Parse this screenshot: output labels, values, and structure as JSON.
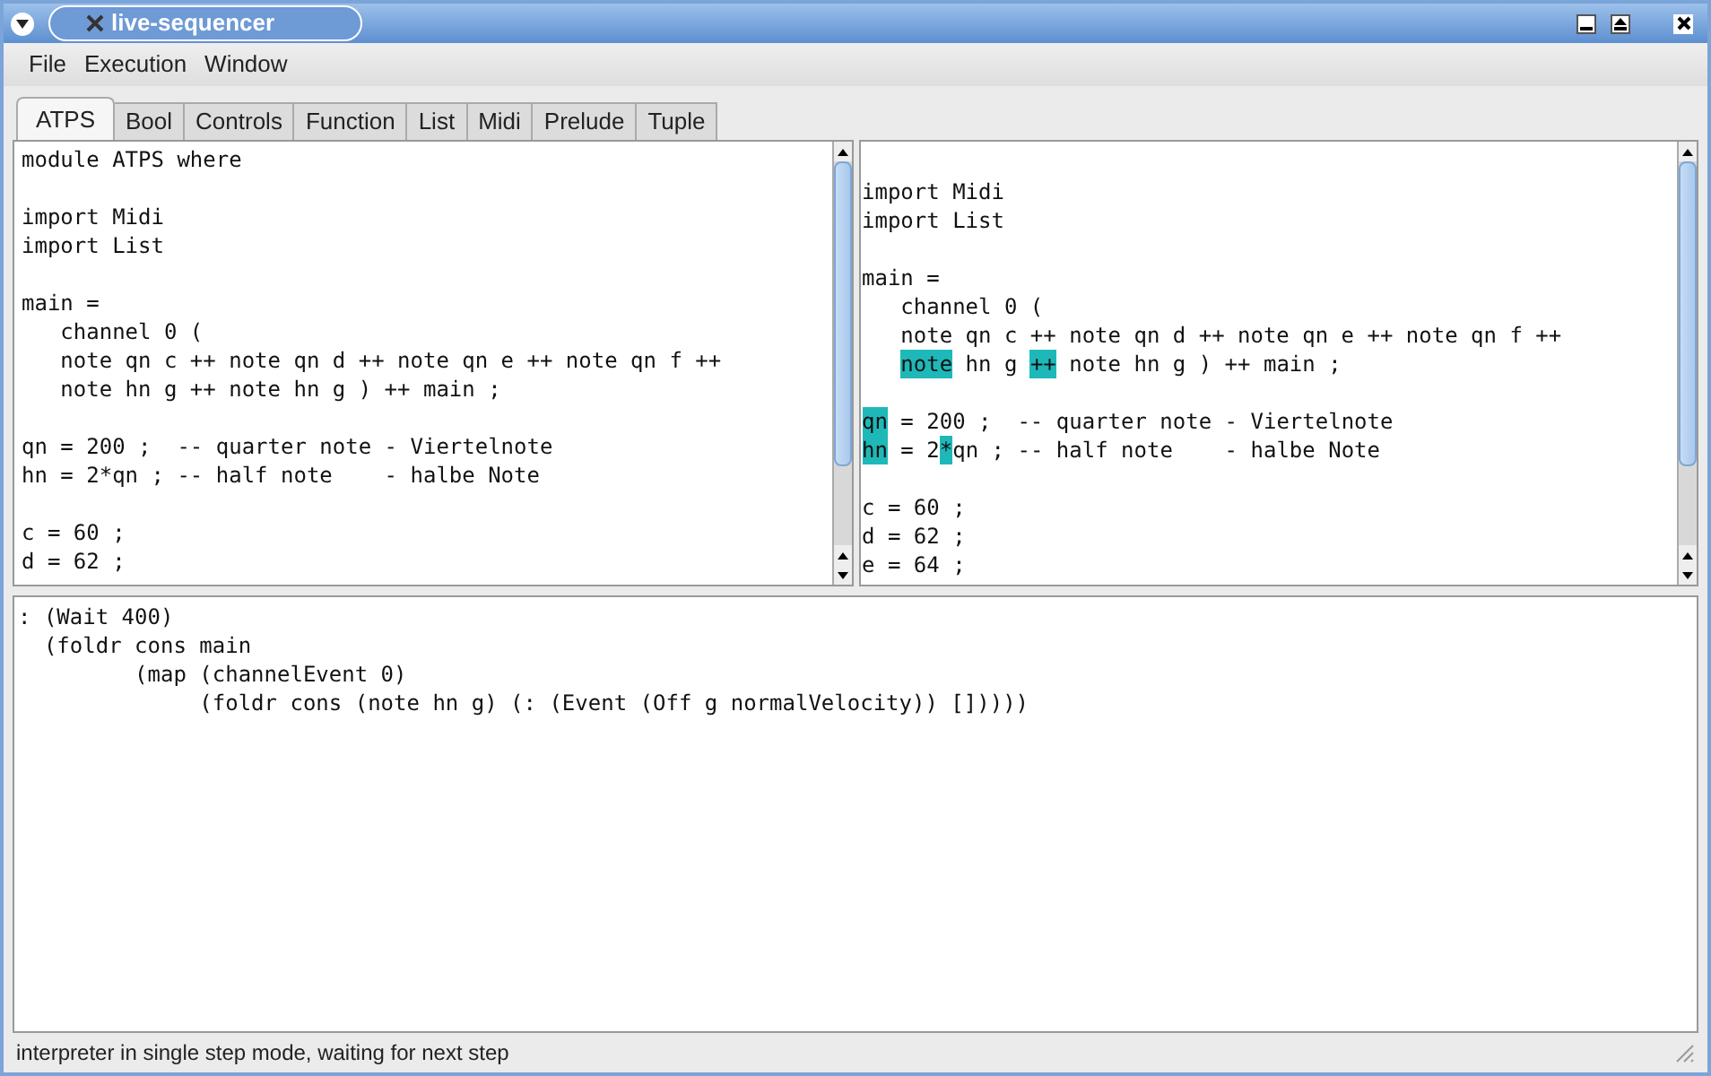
{
  "window": {
    "title": "live-sequencer"
  },
  "menu": [
    "File",
    "Execution",
    "Window"
  ],
  "tabs": [
    {
      "label": "ATPS",
      "selected": true
    },
    {
      "label": "Bool",
      "selected": false
    },
    {
      "label": "Controls",
      "selected": false
    },
    {
      "label": "Function",
      "selected": false
    },
    {
      "label": "List",
      "selected": false
    },
    {
      "label": "Midi",
      "selected": false
    },
    {
      "label": "Prelude",
      "selected": false
    },
    {
      "label": "Tuple",
      "selected": false
    }
  ],
  "source_editor": {
    "blocks": [
      [
        "module ATPS where"
      ],
      [
        "import Midi",
        "import List"
      ],
      [
        "main =",
        "   channel 0 (",
        "   note qn c ++ note qn d ++ note qn e ++ note qn f ++",
        "   note hn g ++ note hn g ) ++ main ;"
      ],
      [
        "qn = 200 ;  -- quarter note - Viertelnote",
        "hn = 2*qn ; -- half note    - halbe Note"
      ],
      [
        "c = 60 ;",
        "d = 62 ;"
      ]
    ]
  },
  "step_editor": {
    "blocks": [
      [
        {
          "indented": false,
          "segments": [
            {
              "text": "import Midi",
              "highlighted": false
            }
          ]
        },
        {
          "indented": false,
          "segments": [
            {
              "text": "import List",
              "highlighted": false
            }
          ]
        }
      ],
      [
        {
          "indented": false,
          "segments": [
            {
              "text": "main =",
              "highlighted": false
            }
          ]
        },
        {
          "indented": true,
          "segments": [
            {
              "text": "channel 0 (",
              "highlighted": false
            }
          ]
        },
        {
          "indented": true,
          "segments": [
            {
              "text": "note qn c ++ note qn d ++ note qn e ++ note qn f ++",
              "highlighted": false
            }
          ]
        },
        {
          "indented": true,
          "segments": [
            {
              "text": "note",
              "highlighted": true
            },
            {
              "text": " hn g ",
              "highlighted": false
            },
            {
              "text": "++",
              "highlighted": true
            },
            {
              "text": " note hn g ) ++ main ;",
              "highlighted": false
            }
          ]
        }
      ],
      [
        {
          "indented": false,
          "segments": [
            {
              "text": "qn",
              "highlighted": true
            },
            {
              "text": " = 200 ;  -- quarter note - Viertelnote",
              "highlighted": false
            }
          ]
        },
        {
          "indented": false,
          "segments": [
            {
              "text": "hn",
              "highlighted": true
            },
            {
              "text": " = 2",
              "highlighted": false
            },
            {
              "text": "*",
              "highlighted": true
            },
            {
              "text": "qn ; -- half note    - halbe Note",
              "highlighted": false
            }
          ]
        }
      ],
      [
        {
          "indented": false,
          "segments": [
            {
              "text": "c = 60 ;",
              "highlighted": false
            }
          ]
        },
        {
          "indented": false,
          "segments": [
            {
              "text": "d = 62 ;",
              "highlighted": false
            }
          ]
        },
        {
          "indented": false,
          "segments": [
            {
              "text": "e = 64 ;",
              "highlighted": false
            }
          ]
        }
      ]
    ]
  },
  "output": {
    "lines": [
      ": (Wait 400)",
      "  (foldr cons main",
      "         (map (channelEvent 0)",
      "              (foldr cons (note hn g) (: (Event (Off g normalVelocity)) []))))"
    ]
  },
  "status_bar": "interpreter in single step mode, waiting for next step"
}
